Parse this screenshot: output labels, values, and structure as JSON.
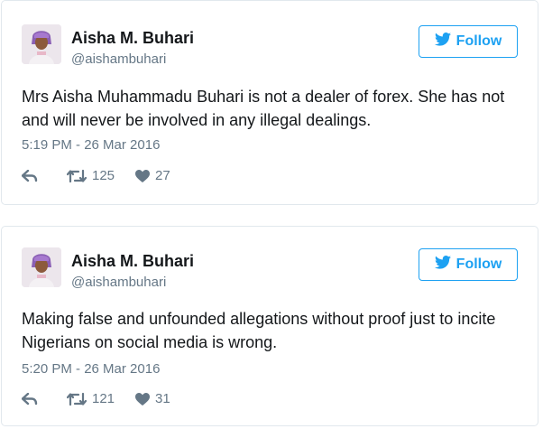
{
  "colors": {
    "accent": "#1da1f2",
    "muted": "#657786",
    "text": "#14171a",
    "border": "#e1e8ed"
  },
  "tweets": [
    {
      "author_name": "Aisha M. Buhari",
      "handle": "@aishambuhari",
      "follow_label": "Follow",
      "text": "Mrs Aisha Muhammadu Buhari is not a dealer of forex. She has not and will never be involved in any illegal dealings.",
      "timestamp": "5:19 PM - 26 Mar 2016",
      "retweets": "125",
      "likes": "27",
      "icons": [
        "reply-icon",
        "retweet-icon",
        "heart-icon",
        "bird-icon"
      ]
    },
    {
      "author_name": "Aisha M. Buhari",
      "handle": "@aishambuhari",
      "follow_label": "Follow",
      "text": "Making false and unfounded allegations without proof just to incite Nigerians on social media is wrong.",
      "timestamp": "5:20 PM - 26 Mar 2016",
      "retweets": "121",
      "likes": "31",
      "icons": [
        "reply-icon",
        "retweet-icon",
        "heart-icon",
        "bird-icon"
      ]
    }
  ]
}
